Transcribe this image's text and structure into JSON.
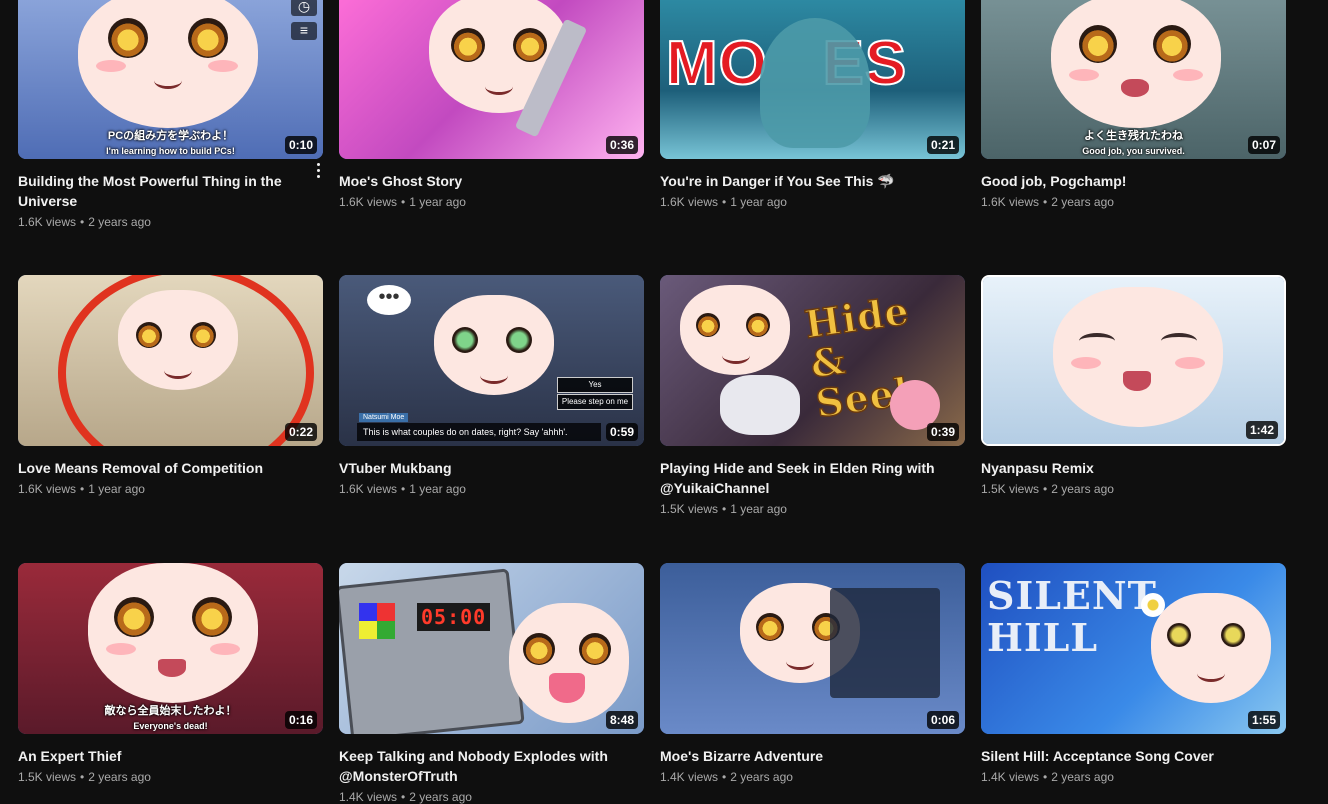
{
  "videos": [
    {
      "title": "Building the Most Powerful Thing in the Universe",
      "views": "1.6K views",
      "age": "2 years ago",
      "duration": "0:10",
      "subtitle": "PCの組み方を学ぶわよ！",
      "subtitle2": "I'm learning how to build PCs!"
    },
    {
      "title": "Moe's Ghost Story",
      "views": "1.6K views",
      "age": "1 year ago",
      "duration": "0:36"
    },
    {
      "title": "You're in Danger if You See This 🦈",
      "views": "1.6K views",
      "age": "1 year ago",
      "duration": "0:21",
      "bigtext": "MO   ES"
    },
    {
      "title": "Good job, Pogchamp!",
      "views": "1.6K views",
      "age": "2 years ago",
      "duration": "0:07",
      "subtitle": "よく生き残れたわね",
      "subtitle2": "Good job, you survived."
    },
    {
      "title": "Love Means Removal of Competition",
      "views": "1.6K views",
      "age": "1 year ago",
      "duration": "0:22"
    },
    {
      "title": "VTuber Mukbang",
      "views": "1.6K views",
      "age": "1 year ago",
      "duration": "0:59",
      "subtitle": "This is what couples do on dates, right? Say 'ahhh'.",
      "choice1": "Yes",
      "choice2": "Please step on me",
      "speaker": "Natsumi Moe"
    },
    {
      "title": "Playing Hide and Seek in Elden Ring with @YuikaiChannel",
      "views": "1.5K views",
      "age": "1 year ago",
      "duration": "0:39",
      "bigtext": "Hide & Seek"
    },
    {
      "title": "Nyanpasu Remix",
      "views": "1.5K views",
      "age": "2 years ago",
      "duration": "1:42"
    },
    {
      "title": "An Expert Thief",
      "views": "1.5K views",
      "age": "2 years ago",
      "duration": "0:16",
      "subtitle": "敵なら全員始末したわよ！",
      "subtitle2": "Everyone's dead!"
    },
    {
      "title": "Keep Talking and Nobody Explodes with @MonsterOfTruth",
      "views": "1.4K views",
      "age": "2 years ago",
      "duration": "8:48",
      "bigtext": "05:00"
    },
    {
      "title": "Moe's Bizarre Adventure",
      "views": "1.4K views",
      "age": "2 years ago",
      "duration": "0:06"
    },
    {
      "title": "Silent Hill: Acceptance Song Cover",
      "views": "1.4K views",
      "age": "2 years ago",
      "duration": "1:55",
      "bigtext": "SILENT HILL"
    }
  ],
  "thumb_colors": [
    "#6a86c8",
    "#d04cc8",
    "#2f8fa8",
    "#5c7a7e",
    "#d9c8a8",
    "#3a4a6a",
    "#5a4a6a",
    "#cfe3f2",
    "#8a2a3a",
    "#8fb0d8",
    "#3c5e9a",
    "#2c6ad8"
  ],
  "dot": "•"
}
